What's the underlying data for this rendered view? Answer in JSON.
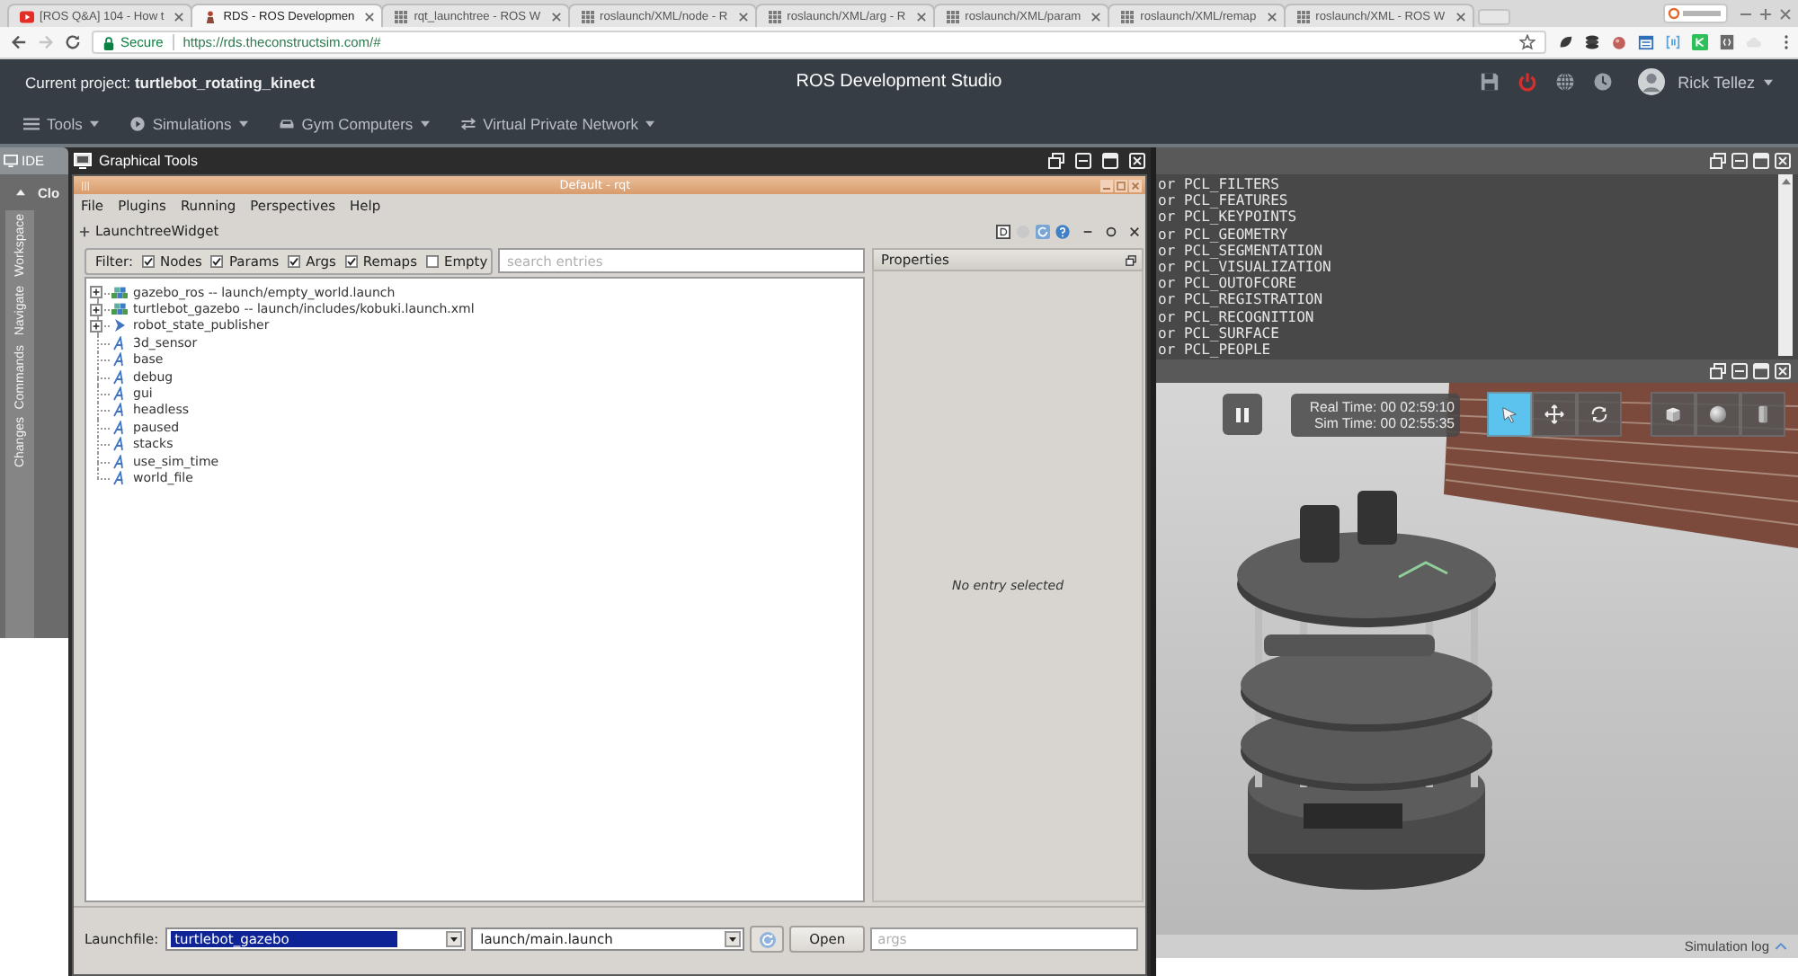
{
  "browser": {
    "tabs": [
      {
        "kind": "video",
        "title": "[ROS Q&A] 104 - How t",
        "selected": false
      },
      {
        "kind": "app",
        "title": "RDS - ROS Developmen",
        "selected": true
      },
      {
        "kind": "page",
        "title": "rqt_launchtree - ROS W",
        "selected": false
      },
      {
        "kind": "page",
        "title": "roslaunch/XML/node - R",
        "selected": false
      },
      {
        "kind": "page",
        "title": "roslaunch/XML/arg - R",
        "selected": false
      },
      {
        "kind": "page",
        "title": "roslaunch/XML/param",
        "selected": false
      },
      {
        "kind": "page",
        "title": "roslaunch/XML/remap",
        "selected": false
      },
      {
        "kind": "page",
        "title": "roslaunch/XML - ROS W",
        "selected": false
      }
    ],
    "security": "Secure",
    "url": "https://rds.theconstructsim.com/#"
  },
  "header": {
    "project": "Current project: **turtlebot_rotating_kinect**",
    "title": "ROS Development Studio",
    "user": "Rick Tellez"
  },
  "menu": [
    "Tools",
    "Simulations",
    "Gym Computers",
    "Virtual Private Network"
  ],
  "ide": {
    "tab": "IDE",
    "cut_tab": "Clo",
    "side_tabs": [
      "Workspace",
      "Navigate",
      "Commands",
      "Changes"
    ]
  },
  "graphical_tools": {
    "title": "Graphical Tools",
    "rqt": {
      "title": "Default - rqt",
      "menu": [
        "File",
        "Plugins",
        "Running",
        "Perspectives",
        "Help"
      ],
      "widget": "LaunchtreeWidget",
      "filter_label": "Filter:",
      "filters": [
        {
          "label": "Nodes",
          "checked": true
        },
        {
          "label": "Params",
          "checked": true
        },
        {
          "label": "Args",
          "checked": true
        },
        {
          "label": "Remaps",
          "checked": true
        },
        {
          "label": "Empty",
          "checked": false
        }
      ],
      "search_placeholder": "search entries",
      "tree": [
        {
          "kind": "launch",
          "label": "gazebo_ros -- launch/empty_world.launch",
          "expanded": false
        },
        {
          "kind": "launch",
          "label": "turtlebot_gazebo -- launch/includes/kobuki.launch.xml",
          "expanded": false
        },
        {
          "kind": "node",
          "label": "robot_state_publisher",
          "expanded": false
        },
        {
          "kind": "arg",
          "label": "3d_sensor"
        },
        {
          "kind": "arg",
          "label": "base"
        },
        {
          "kind": "arg",
          "label": "debug"
        },
        {
          "kind": "arg",
          "label": "gui"
        },
        {
          "kind": "arg",
          "label": "headless"
        },
        {
          "kind": "arg",
          "label": "paused"
        },
        {
          "kind": "arg",
          "label": "stacks"
        },
        {
          "kind": "arg",
          "label": "use_sim_time"
        },
        {
          "kind": "arg",
          "label": "world_file"
        }
      ],
      "properties": {
        "title": "Properties",
        "message": "No entry selected"
      },
      "launchfile": {
        "label": "Launchfile:",
        "package": "turtlebot_gazebo",
        "package_text_selected": true,
        "file": "launch/main.launch",
        "open": "Open",
        "args_placeholder": "args"
      }
    }
  },
  "terminal": {
    "lines": [
      "or PCL_FILTERS",
      "or PCL_FEATURES",
      "or PCL_KEYPOINTS",
      "or PCL_GEOMETRY",
      "or PCL_SEGMENTATION",
      "or PCL_VISUALIZATION",
      "or PCL_OUTOFCORE",
      "or PCL_REGISTRATION",
      "or PCL_RECOGNITION",
      "or PCL_SURFACE",
      "or PCL_PEOPLE"
    ]
  },
  "simulation": {
    "running": true,
    "real_time": "Real Time: 00 02:59:10",
    "sim_time": "Sim Time: 00 02:55:35",
    "modes": [
      {
        "kind": "select",
        "selected": true
      },
      {
        "kind": "translate",
        "selected": false
      },
      {
        "kind": "rotate",
        "selected": false
      }
    ],
    "shapes": [
      {
        "kind": "box"
      },
      {
        "kind": "sphere"
      },
      {
        "kind": "cylinder"
      }
    ],
    "log": "Simulation log"
  }
}
